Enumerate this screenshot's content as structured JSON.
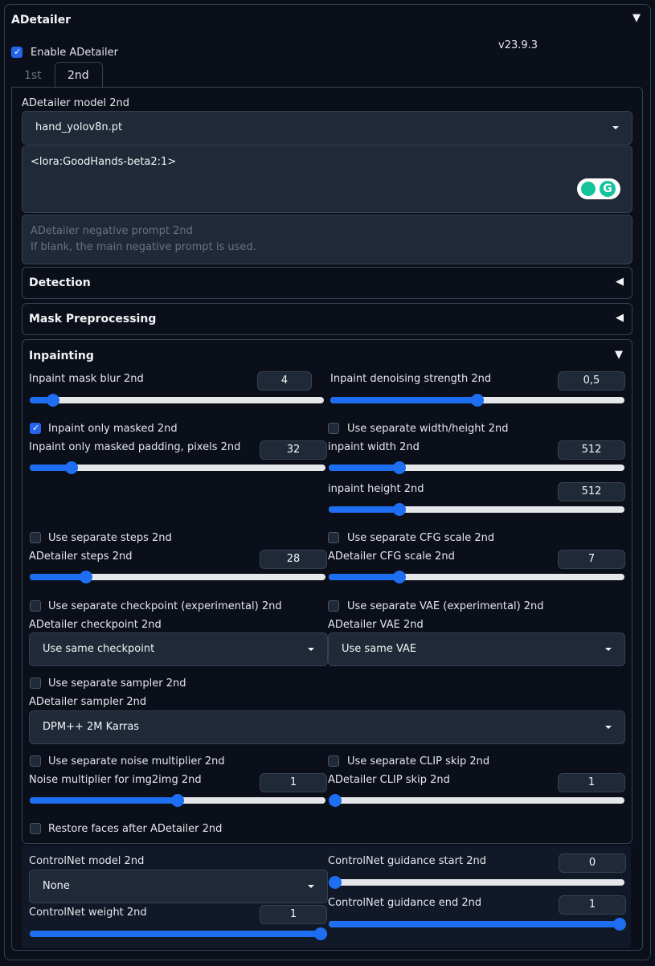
{
  "header": {
    "title": "ADetailer",
    "version": "v23.9.3"
  },
  "enable_label": "Enable ADetailer",
  "tabs": [
    {
      "label": "1st"
    },
    {
      "label": "2nd"
    }
  ],
  "model": {
    "label": "ADetailer model 2nd",
    "value": "hand_yolov8n.pt"
  },
  "prompt": {
    "value": "<lora:GoodHands-beta2:1>"
  },
  "negative_prompt": {
    "placeholder_line1": "ADetailer negative prompt 2nd",
    "placeholder_line2": "If blank, the main negative prompt is used."
  },
  "sections": {
    "detection": "Detection",
    "mask": "Mask Preprocessing",
    "inpainting": "Inpainting"
  },
  "inpaint": {
    "mask_blur": {
      "label": "Inpaint mask blur 2nd",
      "value": "4",
      "fraction": 0.08
    },
    "denoise": {
      "label": "Inpaint denoising strength 2nd",
      "value": "0,5",
      "fraction": 0.5
    },
    "only_masked": {
      "label": "Inpaint only masked 2nd"
    },
    "separate_wh": {
      "label": "Use separate width/height 2nd"
    },
    "padding": {
      "label": "Inpaint only masked padding, pixels 2nd",
      "value": "32",
      "fraction": 0.14
    },
    "width": {
      "label": "inpaint width 2nd",
      "value": "512",
      "fraction": 0.24
    },
    "height": {
      "label": "inpaint height 2nd",
      "value": "512",
      "fraction": 0.24
    },
    "sep_steps": {
      "label": "Use separate steps 2nd"
    },
    "sep_cfg": {
      "label": "Use separate CFG scale 2nd"
    },
    "steps": {
      "label": "ADetailer steps 2nd",
      "value": "28",
      "fraction": 0.19
    },
    "cfg": {
      "label": "ADetailer CFG scale 2nd",
      "value": "7",
      "fraction": 0.24
    },
    "sep_ckpt": {
      "label": "Use separate checkpoint (experimental) 2nd"
    },
    "sep_vae": {
      "label": "Use separate VAE (experimental) 2nd"
    },
    "ckpt_label": "ADetailer checkpoint 2nd",
    "ckpt_value": "Use same checkpoint",
    "vae_label": "ADetailer VAE 2nd",
    "vae_value": "Use same VAE",
    "sep_sampler": {
      "label": "Use separate sampler 2nd"
    },
    "sampler_label": "ADetailer sampler 2nd",
    "sampler_value": "DPM++ 2M Karras",
    "sep_noise": {
      "label": "Use separate noise multiplier 2nd"
    },
    "sep_clip": {
      "label": "Use separate CLIP skip 2nd"
    },
    "noise": {
      "label": "Noise multiplier for img2img 2nd",
      "value": "1",
      "fraction": 0.5
    },
    "clip": {
      "label": "ADetailer CLIP skip 2nd",
      "value": "1",
      "fraction": 0.0
    },
    "restore_faces": {
      "label": "Restore faces after ADetailer 2nd"
    }
  },
  "controlnet": {
    "model_label": "ControlNet model 2nd",
    "model_value": "None",
    "start": {
      "label": "ControlNet guidance start 2nd",
      "value": "0",
      "fraction": 0.0
    },
    "weight": {
      "label": "ControlNet weight 2nd",
      "value": "1",
      "fraction": 1.0
    },
    "end": {
      "label": "ControlNet guidance end 2nd",
      "value": "1",
      "fraction": 1.0
    }
  }
}
